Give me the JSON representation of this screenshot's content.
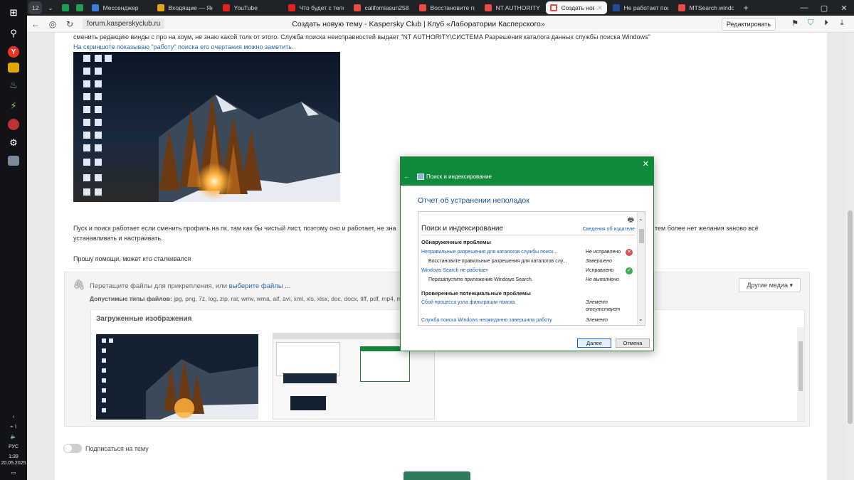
{
  "taskbar": {
    "tab_count": "12",
    "lang": "РУС",
    "time": "1:39",
    "date": "20.05.2025"
  },
  "tabs": [
    {
      "label": "Мессенджер",
      "color": "#3a7bd5"
    },
    {
      "label": "Входящие — Янд",
      "color": "#e8a317"
    },
    {
      "label": "YouTube",
      "color": "#e62117"
    },
    {
      "label": "Что будет с тело",
      "color": "#e62117"
    },
    {
      "label": "californiasun258",
      "color": "#e74c3c"
    },
    {
      "label": "Восстановите пр",
      "color": "#e74c3c"
    },
    {
      "label": "NT AUTHORITY\\",
      "color": "#e74c3c"
    },
    {
      "label": "Создать нову",
      "color": "#ffffff",
      "active": true
    },
    {
      "label": "Не работает пои",
      "color": "#1e4c9a"
    },
    {
      "label": "MTSearch windo",
      "color": "#e74c3c"
    }
  ],
  "addressbar": {
    "url": "forum.kasperskyclub.ru",
    "title": "Создать новую тему - Kaspersky Club | Клуб «Лаборатории Касперского»",
    "edit_label": "Редактировать"
  },
  "post": {
    "line1": "сменить редакцию винды с про на хоум, не знаю какой толк от этого. Служба поиска неисправностей выдает \"NT AUTHORITY\\СИСТЕМА Разрешения каталога данных службы поиска Windows\"",
    "line2": "На скриншоте показываю \"работу\" поиска его очертания можно заметить.",
    "para1_a": "Пуск и поиск работает если сменить профиль на пк, там как бы чистый лист, поэтому оно и работает, не зна",
    "para1_b": "тем более нет желания заново всё",
    "para1_c": "устанавливать и настраивать.",
    "para2": "Прошу помощи, может кто сталкивался"
  },
  "upload": {
    "hint_prefix": "Перетащите файлы для прикрепления, или ",
    "hint_link": "выберите файлы ...",
    "types_label": "Допустимые типы файлов:",
    "types": " jpg, png, 7z, log, zip, rar, wmv, wma, aif, avi, xml, xls, xlsx, doc, docx, tiff, pdf, mp4, m",
    "other_media": "Другие медиа ▾",
    "images_title": "Загруженные изображения"
  },
  "subscribe_label": "Подписаться на тему",
  "dialog": {
    "window_title": "Поиск и индексирование",
    "heading": "Отчет об устранении неполадок",
    "report_title": "Поиск и индексирование",
    "details_link": "Сведения об издателе",
    "section_found": "Обнаруженные проблемы",
    "section_checked": "Проверенные потенциальные проблемы",
    "rows_found": [
      {
        "name": "Неправильные разрешения для каталогов службы поиск...",
        "status": "Не исправлено",
        "icon": "error"
      },
      {
        "sub": "Восстановите правильные разрешения для каталогов слу...",
        "status": "Завершено",
        "italic": true
      },
      {
        "name": "Windows Search не работает",
        "status": "Исправлено",
        "icon": "ok"
      },
      {
        "sub": "Перезапустите приложение Windows Search.",
        "status": "Не выполнено",
        "italic": true
      }
    ],
    "rows_checked": [
      {
        "name": "Сбой процесса узла фильтрации поиска",
        "status": "Элемент",
        "status2": "отсутствует"
      },
      {
        "name": "Служба поиска Windows неожиданно завершила работу",
        "status": "Элемент"
      }
    ],
    "next_label": "Далее",
    "cancel_label": "Отмена"
  },
  "colors": {
    "dialog_header": "#0f8a3a",
    "link": "#1a5fae",
    "error": "#d9534f",
    "ok": "#3cae4a"
  }
}
